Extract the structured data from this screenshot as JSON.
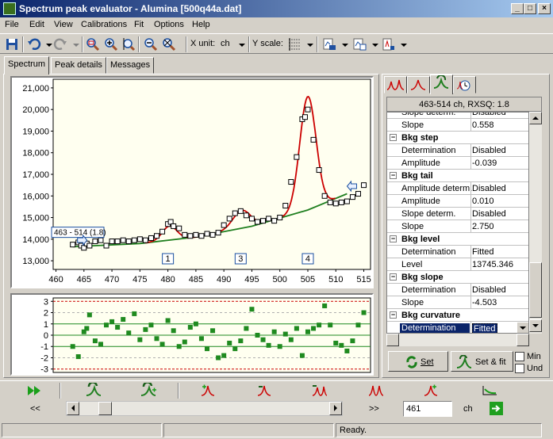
{
  "window": {
    "title": "Spectrum peak evaluator - Alumina [500q44a.dat]"
  },
  "menu": [
    "File",
    "Edit",
    "View",
    "Calibrations",
    "Fit",
    "Options",
    "Help"
  ],
  "toolbar": {
    "xunit_label": "X unit:",
    "xunit_value": "ch",
    "yscale_label": "Y scale:"
  },
  "tabs": [
    {
      "label": "Spectrum",
      "active": true
    },
    {
      "label": "Peak details",
      "active": false
    },
    {
      "label": "Messages",
      "active": false
    }
  ],
  "chart_data": [
    {
      "type": "scatter",
      "name_hint": "spectrum",
      "x_ticks": [
        460,
        465,
        470,
        475,
        480,
        485,
        490,
        495,
        500,
        505,
        510,
        515
      ],
      "y_ticks": [
        13000,
        14000,
        15000,
        16000,
        17000,
        18000,
        19000,
        20000,
        21000
      ],
      "y_tick_labels": [
        "13,000",
        "14,000",
        "15,000",
        "16,000",
        "17,000",
        "18,000",
        "19,000",
        "20,000",
        "21,000"
      ],
      "xlim": [
        459.5,
        516.2
      ],
      "ylim": [
        12600,
        21400
      ],
      "x": [
        463,
        464,
        464.5,
        465,
        465.5,
        466,
        467,
        468,
        469,
        470,
        471,
        472,
        473,
        474,
        475,
        476,
        477,
        478,
        479,
        480,
        480.5,
        481,
        482,
        483,
        484,
        485,
        486,
        487,
        488,
        489,
        490,
        491,
        492,
        493,
        494,
        495,
        496,
        497,
        498,
        499,
        500,
        501,
        502,
        503,
        504,
        504.5,
        505,
        506,
        507,
        508,
        509,
        510,
        511,
        512,
        513,
        514,
        515
      ],
      "y": [
        13750,
        13850,
        13700,
        13600,
        13800,
        13700,
        13900,
        13950,
        13700,
        13900,
        13900,
        13950,
        13900,
        13950,
        14000,
        13950,
        14050,
        14150,
        14350,
        14700,
        14800,
        14600,
        14500,
        14200,
        14150,
        14200,
        14150,
        14250,
        14200,
        14300,
        14650,
        14950,
        15200,
        15300,
        15100,
        14950,
        14800,
        14850,
        14950,
        14850,
        15000,
        15550,
        16650,
        17800,
        19550,
        19650,
        20000,
        18600,
        17200,
        16000,
        15700,
        15650,
        15700,
        15750,
        15950,
        16100,
        16500
      ],
      "fit_curve": {
        "color": "#cc0000"
      },
      "baseline": {
        "color": "#1f7f1f",
        "x": [
          463,
          475,
          485,
          495,
          505,
          512
        ],
        "y": [
          13650,
          13800,
          14100,
          14600,
          15350,
          16100
        ]
      },
      "peak_markers": [
        {
          "label": "1",
          "x": 480
        },
        {
          "label": "3",
          "x": 493
        },
        {
          "label": "4",
          "x": 505
        }
      ],
      "annotation": {
        "text": "463 - 514 (1.8)"
      }
    },
    {
      "type": "scatter",
      "name_hint": "residuals",
      "y_ticks": [
        3,
        2,
        1,
        0,
        -1,
        -2,
        -3
      ],
      "y_tick_labels": [
        "3",
        "2",
        "1",
        "0",
        "-1",
        "-2",
        "-3"
      ],
      "ylim": [
        -3.3,
        3.3
      ],
      "x": [
        463,
        464,
        465,
        465.5,
        466,
        467,
        468,
        469,
        470,
        471,
        472,
        473,
        474,
        475,
        476,
        477,
        478,
        479,
        480,
        481,
        482,
        483,
        484,
        485,
        486,
        487,
        488,
        489,
        490,
        491,
        492,
        493,
        494,
        495,
        496,
        497,
        498,
        499,
        500,
        501,
        502,
        503,
        504,
        505,
        506,
        507,
        508,
        509,
        510,
        511,
        512,
        513,
        514,
        515
      ],
      "y": [
        -1,
        -1.9,
        0.3,
        0.6,
        1.8,
        -0.5,
        -0.8,
        0.9,
        1.2,
        0.7,
        1.4,
        0.2,
        1.9,
        -0.4,
        0.5,
        0.9,
        -0.3,
        -0.8,
        1.3,
        0.4,
        -1,
        -0.6,
        0.7,
        1.0,
        -0.3,
        -1.2,
        0.4,
        -2,
        -1.8,
        -0.7,
        -1.2,
        -0.5,
        0.6,
        2.3,
        0.0,
        -0.4,
        -0.9,
        0.3,
        -1,
        0.1,
        -0.4,
        0.6,
        -1.8,
        0.3,
        0.6,
        0.9,
        2.6,
        0.9,
        -0.7,
        -0.9,
        -1.4,
        -0.5,
        0.9,
        2.0
      ],
      "point_color": "#1f8a1f",
      "limit_lines": {
        "outer": 3,
        "inner": 1,
        "outer_color": "#cc0000",
        "inner_color": "#1f8a1f"
      }
    }
  ],
  "right_panel": {
    "header": "463-514 ch, RXSQ: 1.8",
    "rows": [
      {
        "type": "prop",
        "name": "Slope determ.",
        "value": "Disabled",
        "partial": true
      },
      {
        "type": "prop",
        "name": "Slope",
        "value": "0.558"
      },
      {
        "type": "cat",
        "name": "Bkg step"
      },
      {
        "type": "prop",
        "name": "Determination",
        "value": "Disabled"
      },
      {
        "type": "prop",
        "name": "Amplitude",
        "value": "-0.039"
      },
      {
        "type": "cat",
        "name": "Bkg tail"
      },
      {
        "type": "prop",
        "name": "Amplitude determ.",
        "value": "Disabled"
      },
      {
        "type": "prop",
        "name": "Amplitude",
        "value": "0.010"
      },
      {
        "type": "prop",
        "name": "Slope determ.",
        "value": "Disabled"
      },
      {
        "type": "prop",
        "name": "Slope",
        "value": "2.750"
      },
      {
        "type": "cat",
        "name": "Bkg level"
      },
      {
        "type": "prop",
        "name": "Determination",
        "value": "Fitted"
      },
      {
        "type": "prop",
        "name": "Level",
        "value": "13745.346"
      },
      {
        "type": "cat",
        "name": "Bkg slope"
      },
      {
        "type": "prop",
        "name": "Determination",
        "value": "Disabled"
      },
      {
        "type": "prop",
        "name": "Slope",
        "value": "-4.503"
      },
      {
        "type": "cat",
        "name": "Bkg curvature"
      },
      {
        "type": "prop",
        "name": "Determination",
        "value": "Fitted",
        "selected": true
      }
    ],
    "set_label": "Set",
    "setfit_label": "Set & fit",
    "check1_label": "Min",
    "check2_label": "Und"
  },
  "scroll": {
    "prev_label": "<<",
    "next_label": ">>",
    "channel_value": "461",
    "unit": "ch",
    "position": 0.08
  },
  "status": {
    "text": "Ready."
  }
}
